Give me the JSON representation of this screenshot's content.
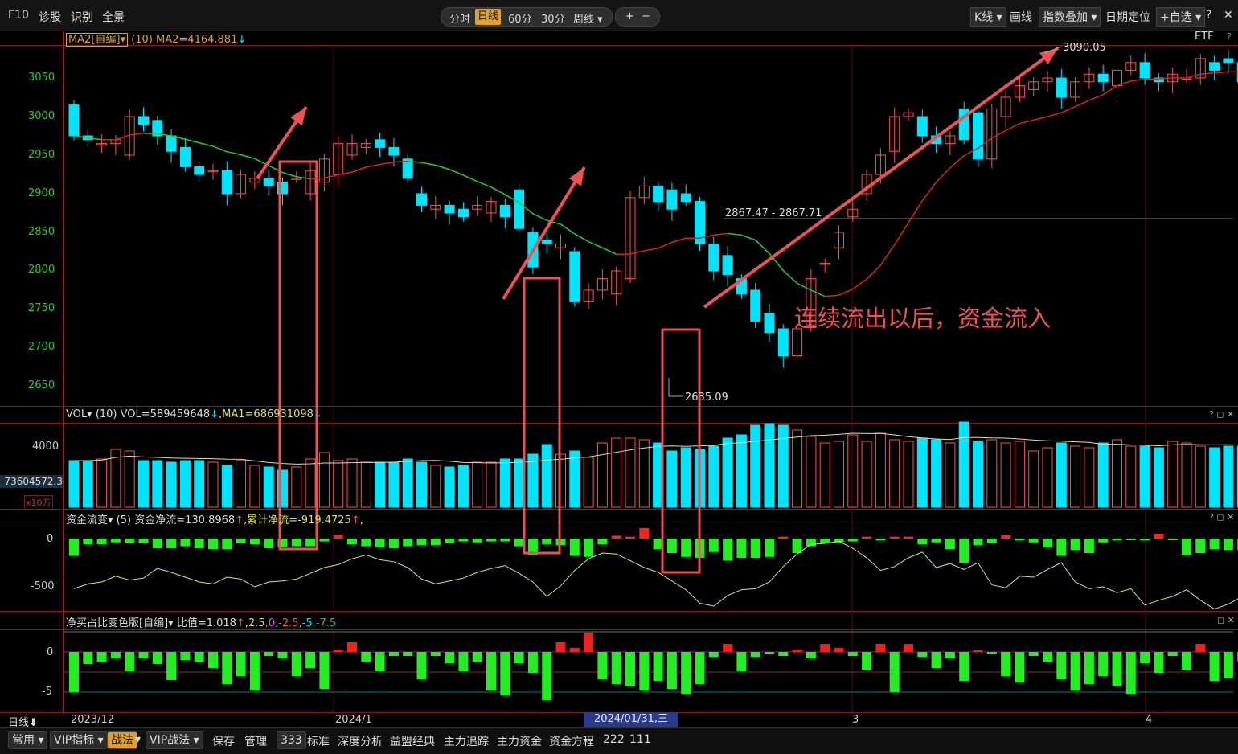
{
  "toolbar": {
    "left": [
      "F10",
      "诊股",
      "识别",
      "全景"
    ],
    "periods": [
      "分时",
      "日线",
      "60分",
      "30分",
      "周线 ▾"
    ],
    "active_period": "日线",
    "zoom": [
      "+",
      "−"
    ],
    "right": [
      "K线 ▾",
      "画线",
      "指数叠加 ▾",
      "日期定位",
      "+自选 ▾",
      "?",
      "✕"
    ]
  },
  "main_header": {
    "indicator": "MA2[自编]▾",
    "param": "(10)",
    "value": "MA2=4164.881",
    "arrow": "↓",
    "etf_label": "ETF"
  },
  "price_axis": [
    "3050",
    "3000",
    "2950",
    "2900",
    "2850",
    "2800",
    "2750",
    "2700",
    "2650"
  ],
  "annotations": {
    "range_label": "2867.47 - 2867.71",
    "high_label": "3090.05",
    "low_label": "2635.09",
    "chinese_note": "连续流出以后，资金流入"
  },
  "vol_header": {
    "name": "VOL▾",
    "param": "(10)",
    "vol": "VOL=589459648",
    "vol_arrow": "↓",
    "ma1": ",MA1=686931098",
    "ma1_arrow": "↓"
  },
  "vol_axis": {
    "tick": "4000",
    "cursor": "73604572.3",
    "unit": "x10万"
  },
  "flow_header": {
    "name": "资金流变▾",
    "param": "(5)",
    "net": "资金净流=130.8968",
    "net_arrow": "↑",
    "cum": ",累计净流=-919.4725",
    "cum_arrow": "↑",
    "tail": ","
  },
  "flow_axis": [
    "0",
    "-500"
  ],
  "ratio_header": {
    "name": "净买占比变色版[自编]▾",
    "label": "比值=1.018",
    "arrow": "↑",
    "levels": [
      ",2.5",
      ",0",
      ",-2.5",
      ",-5",
      ",-7.5"
    ]
  },
  "ratio_axis": [
    "0",
    "-5"
  ],
  "x_axis": {
    "cycle": "日线⬇",
    "labels": [
      "2023/12",
      "2024/1",
      "3",
      "4"
    ],
    "cursor_date": "2024/01/31,三"
  },
  "bottom_tabs": [
    "常用 ▾",
    "VIP指标 ▾",
    "战法",
    "▾",
    "VIP战法 ▾",
    "保存",
    "管理",
    "333",
    "标准",
    "深度分析",
    "益盟经典",
    "主力追踪",
    "主力资金",
    "资金方程",
    "222",
    "111"
  ],
  "colors": {
    "up": "#ff5050",
    "down": "#00e5ff",
    "ma": "#20d020",
    "annot": "#f05050",
    "flow_up": "#ff2020",
    "flow_down": "#22ee22"
  },
  "chart_data": [
    {
      "type": "candlestick",
      "ylim": [
        2620,
        3080
      ],
      "open": [
        3015,
        2975,
        2965,
        2965,
        2950,
        3000,
        2995,
        2975,
        2960,
        2935,
        2930,
        2930,
        2900,
        2915,
        2920,
        2915,
        2920,
        2900,
        2915,
        2925,
        2950,
        2960,
        2970,
        2960,
        2945,
        2900,
        2880,
        2885,
        2880,
        2880,
        2875,
        2885,
        2905,
        2850,
        2840,
        2830,
        2825,
        2760,
        2775,
        2770,
        2790,
        2895,
        2910,
        2905,
        2900,
        2890,
        2835,
        2820,
        2790,
        2775,
        2745,
        2725,
        2690,
        2730,
        2810,
        2830,
        2870,
        2900,
        2925,
        2955,
        3000,
        3000,
        2975,
        2965,
        3010,
        3005,
        2945,
        3000,
        3025,
        3035,
        3045,
        3050,
        3025,
        3045,
        3055,
        3040,
        3060,
        3070,
        3050,
        3045,
        3050,
        3050,
        3070,
        3075,
        3070,
        3050,
        3035,
        3025,
        3030,
        3010,
        2985,
        3000,
        3045,
        3075,
        3070,
        3070,
        3040,
        3045,
        3045,
        3025
      ],
      "close": [
        2975,
        2970,
        2965,
        2970,
        3000,
        2990,
        2975,
        2955,
        2935,
        2925,
        2930,
        2900,
        2925,
        2920,
        2910,
        2900,
        2920,
        2930,
        2945,
        2965,
        2965,
        2965,
        2960,
        2950,
        2920,
        2885,
        2885,
        2875,
        2870,
        2885,
        2890,
        2870,
        2855,
        2805,
        2835,
        2835,
        2760,
        2775,
        2790,
        2800,
        2895,
        2910,
        2890,
        2880,
        2890,
        2835,
        2800,
        2795,
        2770,
        2735,
        2720,
        2690,
        2725,
        2790,
        2810,
        2850,
        2880,
        2925,
        2950,
        3000,
        3005,
        2975,
        2965,
        2975,
        2970,
        2945,
        3010,
        3025,
        3040,
        3045,
        3050,
        3025,
        3045,
        3055,
        3045,
        3060,
        3070,
        3050,
        3045,
        3055,
        3050,
        3075,
        3060,
        3070,
        3045,
        3035,
        3030,
        3015,
        3005,
        2985,
        3005,
        3045,
        3070,
        3080,
        3065,
        3055,
        3040,
        3050,
        3025,
        3050
      ]
    },
    {
      "type": "line",
      "name": "MA2",
      "ylim": [
        2620,
        3080
      ]
    },
    {
      "type": "bar",
      "name": "VOL",
      "ylim": [
        0,
        5200
      ],
      "values": [
        2900,
        2900,
        3000,
        3600,
        3500,
        2900,
        2900,
        2800,
        2900,
        2900,
        2800,
        2600,
        2900,
        2600,
        2500,
        2300,
        2500,
        3000,
        3400,
        2900,
        3000,
        2800,
        2800,
        2800,
        3000,
        2800,
        2600,
        2500,
        2600,
        2800,
        2800,
        3000,
        3000,
        3300,
        3900,
        3300,
        3500,
        3100,
        4000,
        4300,
        4300,
        4200,
        4000,
        3500,
        3700,
        3600,
        3800,
        4300,
        4500,
        5100,
        5200,
        5100,
        4800,
        4400,
        4000,
        4100,
        4500,
        4100,
        4600,
        4200,
        4100,
        4300,
        4200,
        4000,
        5300,
        4100,
        4200,
        4000,
        4100,
        3500,
        3700,
        4000,
        3800,
        3700,
        4000,
        4200,
        3800,
        3800,
        3700,
        4100,
        4000,
        3800,
        3700,
        3800,
        3800,
        3700,
        3500,
        3500,
        3500,
        3400,
        3600,
        3600,
        3700,
        3700,
        3800,
        3800,
        3600,
        3700,
        3500,
        3500
      ]
    },
    {
      "type": "bar",
      "name": "资金流变",
      "ylim": [
        -780,
        150
      ],
      "values": [
        -180,
        -60,
        -60,
        -40,
        -50,
        -50,
        -100,
        -100,
        -80,
        -100,
        -110,
        -110,
        -50,
        -60,
        -100,
        -90,
        -80,
        -80,
        -30,
        40,
        -60,
        -80,
        -90,
        -100,
        -80,
        -70,
        -70,
        -50,
        -30,
        -40,
        -30,
        -30,
        -80,
        -170,
        -60,
        -70,
        -180,
        -190,
        -60,
        30,
        20,
        110,
        -110,
        -150,
        -190,
        -200,
        -140,
        -230,
        -200,
        -200,
        -190,
        20,
        -150,
        -80,
        -50,
        -40,
        -30,
        20,
        -20,
        20,
        20,
        -60,
        -40,
        -110,
        -250,
        -70,
        -50,
        40,
        -20,
        -40,
        -90,
        -180,
        -120,
        -150,
        -40,
        -20,
        -10,
        -20,
        50,
        -10,
        -170,
        -150,
        -110,
        -120,
        -120,
        -120,
        -100,
        -120,
        -200,
        -150,
        -170,
        -150,
        -100,
        -50,
        -10,
        -20,
        -130,
        -100,
        -70,
        -30,
        -40,
        -200,
        -50
      ],
      "line": [
        -520,
        -470,
        -450,
        -390,
        -430,
        -410,
        -310,
        -350,
        -400,
        -450,
        -470,
        -400,
        -420,
        -500,
        -450,
        -440,
        -420,
        -360,
        -300,
        -270,
        -210,
        -170,
        -220,
        -240,
        -300,
        -420,
        -470,
        -440,
        -410,
        -350,
        -310,
        -280,
        -360,
        -450,
        -600,
        -490,
        -330,
        -210,
        -150,
        -160,
        -230,
        -300,
        -350,
        -440,
        -530,
        -670,
        -700,
        -590,
        -530,
        -520,
        -450,
        -290,
        -160,
        -60,
        -50,
        -30,
        -100,
        -200,
        -330,
        -290,
        -200,
        -140,
        -300,
        -260,
        -320,
        -250,
        -480,
        -510,
        -390,
        -400,
        -320,
        -250,
        -450,
        -520,
        -500,
        -560,
        -520,
        -690,
        -640,
        -600,
        -530,
        -640,
        -730,
        -680,
        -600,
        -500,
        -550,
        -600,
        -580,
        -420,
        -280,
        -300,
        -360,
        -430,
        -550,
        -460
      ]
    },
    {
      "type": "bar",
      "name": "净买占比",
      "ylim": [
        -7.5,
        2.5
      ],
      "values": [
        -5,
        -1.5,
        -1.2,
        -0.8,
        -2.4,
        -0.8,
        -1.5,
        -3.5,
        -1,
        -1.2,
        -2,
        -4,
        -3,
        -4.8,
        -0.5,
        -0.8,
        -3,
        -2,
        -4.6,
        0.3,
        1.2,
        -1.2,
        -2.4,
        -0.5,
        -0.5,
        -3.4,
        -0.5,
        -1.4,
        -2.4,
        -1.2,
        -4.8,
        -5.4,
        -1.4,
        -2.6,
        -6,
        1.2,
        0.5,
        2.4,
        -3.4,
        -4,
        -4.2,
        -4.8,
        -3.6,
        -4.6,
        -5.2,
        -4,
        -0.6,
        1,
        -2.4,
        -0.6,
        -0.3,
        -0.5,
        0.3,
        -0.8,
        1,
        0.5,
        -0.5,
        -2.2,
        1,
        -5,
        1,
        -0.6,
        -2,
        -0.8,
        -3.6,
        0.2,
        -0.3,
        -3,
        -3.8,
        -0.5,
        -1.2,
        -3.4,
        -4.8,
        -4,
        -3,
        -4.2,
        -5.2,
        -1.4,
        -2.6,
        -0.5,
        -2.2,
        1,
        -3.6,
        -3.2,
        -1.2,
        -2.4,
        -3.8,
        -4.8,
        -1.8,
        -1.2,
        -0.8,
        -1.2,
        -0.8,
        -3.2,
        -2.4,
        -1.2,
        -4.8,
        -1.8,
        -0.6,
        -0.5
      ]
    }
  ]
}
